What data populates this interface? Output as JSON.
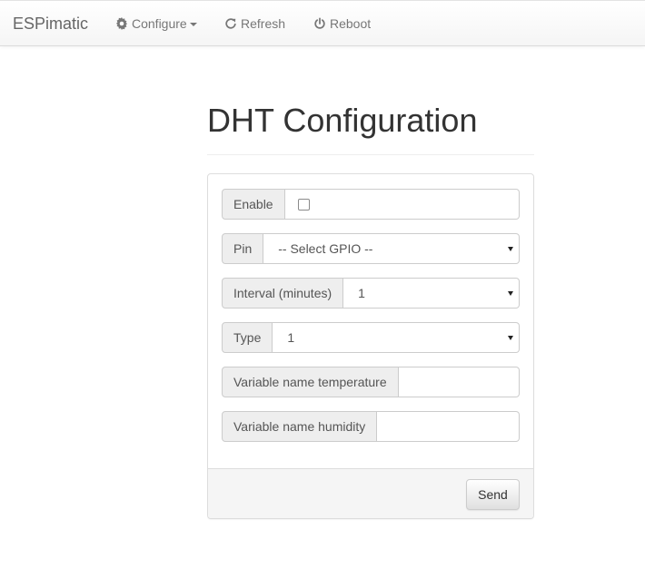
{
  "navbar": {
    "brand": "ESPimatic",
    "items": [
      {
        "label": "Configure",
        "icon": "gear-icon",
        "dropdown": true
      },
      {
        "label": "Refresh",
        "icon": "refresh-icon"
      },
      {
        "label": "Reboot",
        "icon": "power-icon"
      }
    ]
  },
  "page": {
    "title": "DHT Configuration"
  },
  "form": {
    "enable": {
      "label": "Enable",
      "checked": false
    },
    "pin": {
      "label": "Pin",
      "value": "-- Select GPIO --"
    },
    "interval": {
      "label": "Interval (minutes)",
      "value": "1"
    },
    "type": {
      "label": "Type",
      "value": "1"
    },
    "var_temperature": {
      "label": "Variable name temperature",
      "value": ""
    },
    "var_humidity": {
      "label": "Variable name humidity",
      "value": ""
    },
    "send_label": "Send"
  },
  "colors": {
    "navbar_text": "#777777",
    "addon_bg": "#eeeeee",
    "border": "#cccccc"
  }
}
